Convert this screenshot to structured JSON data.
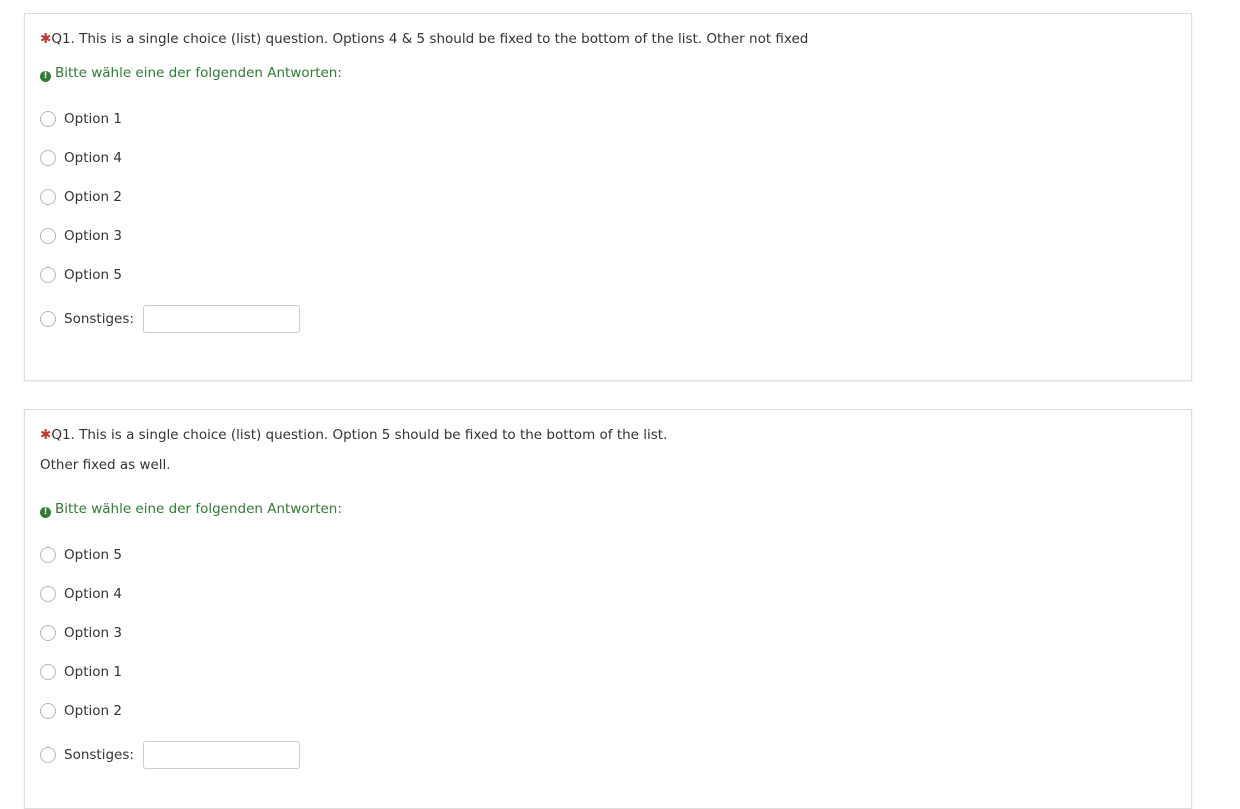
{
  "questions": [
    {
      "mandatory_mark": "✱",
      "title": "Q1. This is a single choice (list) question. Options 4 & 5 should be fixed to the bottom of the list. Other not fixed",
      "subtitle": "",
      "help_icon": "!",
      "help": "Bitte wähle eine der folgenden Antworten:",
      "options": [
        "Option 1",
        "Option 4",
        "Option 2",
        "Option 3",
        "Option 5"
      ],
      "other_label": "Sonstiges:",
      "other_value": ""
    },
    {
      "mandatory_mark": "✱",
      "title": "Q1. This is a single choice (list) question. Option 5 should be fixed to the bottom of the list.",
      "subtitle": "Other fixed as well.",
      "help_icon": "!",
      "help": "Bitte wähle eine der folgenden Antworten:",
      "options": [
        "Option 5",
        "Option 4",
        "Option 3",
        "Option 1",
        "Option 2"
      ],
      "other_label": "Sonstiges:",
      "other_value": ""
    }
  ],
  "colors": {
    "mandatory": "#c0392b",
    "help_text": "#2e7d32",
    "border": "#dddddd"
  }
}
